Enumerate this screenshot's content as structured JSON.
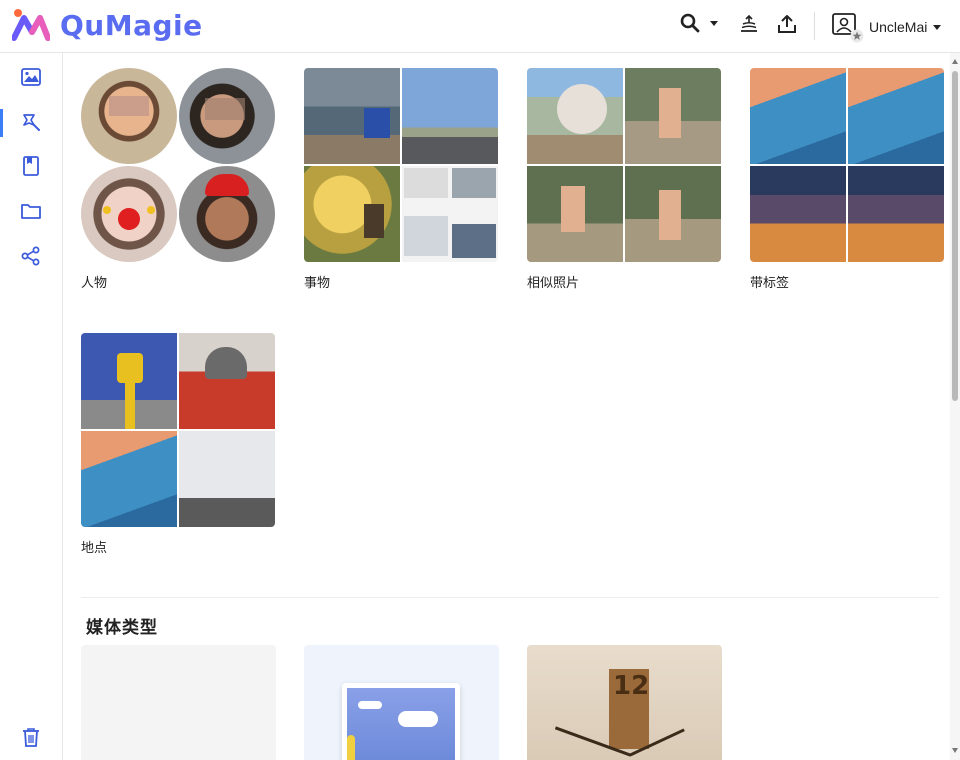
{
  "app": {
    "name": "QuMagie"
  },
  "header": {
    "user_name": "UncleMai"
  },
  "sidebar": {
    "items": [
      {
        "icon": "photos-icon",
        "active": false
      },
      {
        "icon": "magic-wand-icon",
        "active": true
      },
      {
        "icon": "album-icon",
        "active": false
      },
      {
        "icon": "folder-icon",
        "active": false
      },
      {
        "icon": "share-icon",
        "active": false
      },
      {
        "icon": "trash-icon",
        "active": false
      }
    ]
  },
  "albums": [
    {
      "label": "人物"
    },
    {
      "label": "事物"
    },
    {
      "label": "相似照片"
    },
    {
      "label": "带标签"
    },
    {
      "label": "地点"
    }
  ],
  "sections": {
    "media_type_title": "媒体类型"
  },
  "media_cards": [
    {
      "icon": "blank-thumbnail"
    },
    {
      "icon": "image-thumbnail"
    },
    {
      "icon": "clock-thumbnail",
      "clock_number": "12"
    }
  ],
  "colors": {
    "brand": "#5a6cf0",
    "accent": "#3b7ef7"
  }
}
